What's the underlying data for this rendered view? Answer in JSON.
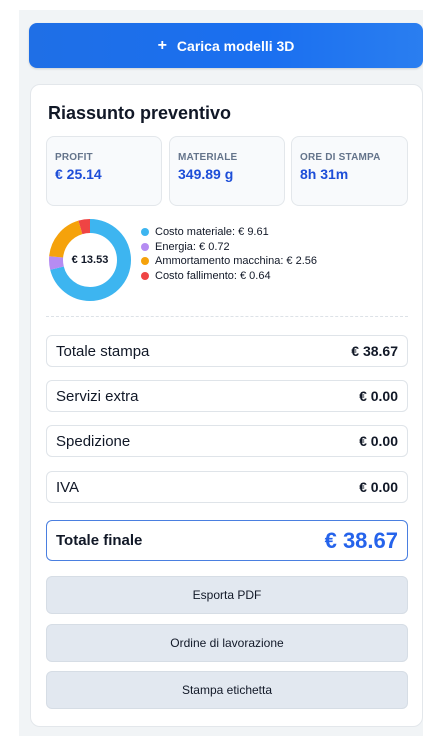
{
  "upload": {
    "icon": "plus-icon",
    "label": "Carica modelli 3D"
  },
  "summary": {
    "title": "Riassunto preventivo",
    "stats": [
      {
        "label": "PROFIT",
        "value": "€ 25.14"
      },
      {
        "label": "MATERIALE",
        "value": "349.89 g"
      },
      {
        "label": "ORE DI STAMPA",
        "value": "8h 31m"
      }
    ],
    "chart_data": {
      "type": "pie",
      "center_label": "€ 13.53",
      "categories": [
        "Costo materiale",
        "Energia",
        "Ammortamento macchina",
        "Costo fallimento"
      ],
      "values": [
        9.61,
        0.72,
        2.56,
        0.64
      ],
      "colors": [
        "#3db5f0",
        "#b58cf2",
        "#f5a20b",
        "#ef4444"
      ],
      "legend_labels": [
        "Costo materiale: € 9.61",
        "Energia: € 0.72",
        "Ammortamento macchina: € 2.56",
        "Costo fallimento: € 0.64"
      ]
    },
    "rows": [
      {
        "label": "Totale stampa",
        "value": "€ 38.67"
      },
      {
        "label": "Servizi extra",
        "value": "€ 0.00"
      },
      {
        "label": "Spedizione",
        "value": "€ 0.00"
      },
      {
        "label": "IVA",
        "value": "€ 0.00"
      }
    ],
    "total": {
      "label": "Totale finale",
      "value": "€ 38.67"
    },
    "actions": [
      "Esporta PDF",
      "Ordine di lavorazione",
      "Stampa etichetta"
    ]
  }
}
